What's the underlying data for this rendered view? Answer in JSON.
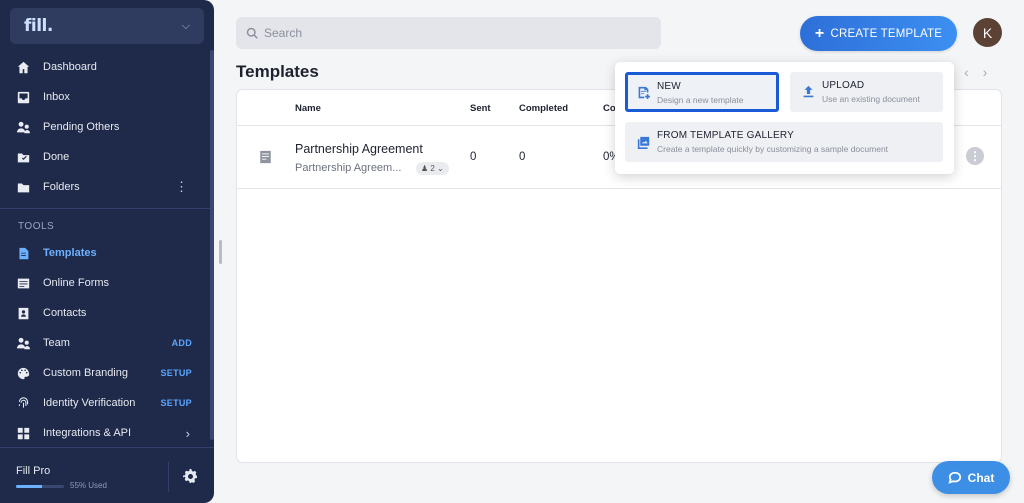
{
  "sidebar": {
    "brand": "fill.",
    "nav": [
      {
        "label": "Dashboard",
        "icon": "home-icon"
      },
      {
        "label": "Inbox",
        "icon": "inbox-icon"
      },
      {
        "label": "Pending Others",
        "icon": "people-icon"
      },
      {
        "label": "Done",
        "icon": "folder-check-icon"
      },
      {
        "label": "Folders",
        "icon": "folder-icon"
      }
    ],
    "tools_label": "TOOLS",
    "tools": [
      {
        "label": "Templates",
        "icon": "templates-icon",
        "active": true
      },
      {
        "label": "Online Forms",
        "icon": "form-icon"
      },
      {
        "label": "Contacts",
        "icon": "contacts-icon"
      },
      {
        "label": "Team",
        "icon": "team-icon",
        "badge": "ADD"
      },
      {
        "label": "Custom Branding",
        "icon": "palette-icon",
        "badge": "SETUP"
      },
      {
        "label": "Identity Verification",
        "icon": "fingerprint-icon",
        "badge": "SETUP"
      },
      {
        "label": "Integrations & API",
        "icon": "puzzle-icon"
      }
    ],
    "footer": {
      "plan": "Fill Pro",
      "usage_percent": 55,
      "usage_text": "55% Used"
    }
  },
  "header": {
    "search_placeholder": "Search",
    "create_label": "CREATE TEMPLATE",
    "avatar_initial": "K"
  },
  "main": {
    "title": "Templates",
    "columns": {
      "name": "Name",
      "sent": "Sent",
      "completed": "Completed",
      "conversion": "Co"
    },
    "rows": [
      {
        "name": "Partnership Agreement",
        "subtitle": "Partnership Agreem...",
        "signers": "2",
        "sent": "0",
        "completed": "0",
        "conversion": "0%"
      }
    ]
  },
  "dropdown": {
    "new": {
      "title": "NEW",
      "desc": "Design a new template"
    },
    "upload": {
      "title": "UPLOAD",
      "desc": "Use an existing document"
    },
    "gallery": {
      "title": "FROM TEMPLATE GALLERY",
      "desc": "Create a template quickly by customizing a sample document"
    }
  },
  "chat_label": "Chat",
  "colors": {
    "sidebar": "#1f2a4a",
    "accent": "#3d8ff2",
    "active": "#6cb0ff",
    "highlight": "#1a5ad4"
  }
}
